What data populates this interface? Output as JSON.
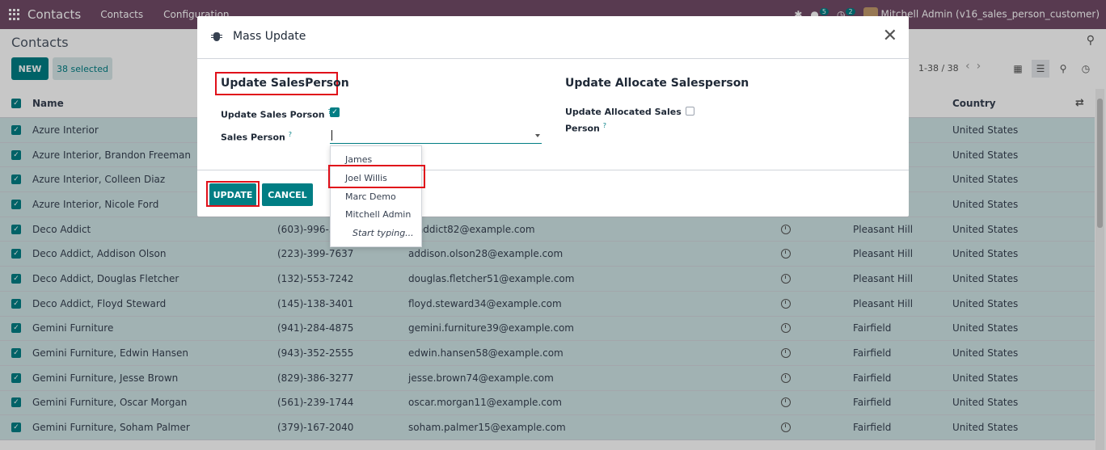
{
  "navbar": {
    "brand": "Contacts",
    "menu": [
      "Contacts",
      "Configuration"
    ],
    "chat_count": "5",
    "activity_count": "2",
    "user": "Mitchell Admin (v16_sales_person_customer)"
  },
  "control_panel": {
    "breadcrumb": "Contacts",
    "new_label": "NEW",
    "selected_label": "38 selected",
    "pager": "1-38 / 38"
  },
  "list": {
    "headers": {
      "name": "Name",
      "country": "Country"
    },
    "rows": [
      {
        "name": "Azure Interior",
        "phone": "",
        "email": "",
        "city": "",
        "country": "United States"
      },
      {
        "name": "Azure Interior, Brandon Freeman",
        "phone": "",
        "email": "",
        "city": "",
        "country": "United States"
      },
      {
        "name": "Azure Interior, Colleen Diaz",
        "phone": "",
        "email": "",
        "city": "",
        "country": "United States"
      },
      {
        "name": "Azure Interior, Nicole Ford",
        "phone": "",
        "email": "",
        "city": "",
        "country": "United States"
      },
      {
        "name": "Deco Addict",
        "phone": "(603)-996-38",
        "email": "o.addict82@example.com",
        "city": "Pleasant Hill",
        "country": "United States"
      },
      {
        "name": "Deco Addict, Addison Olson",
        "phone": "(223)-399-7637",
        "email": "addison.olson28@example.com",
        "city": "Pleasant Hill",
        "country": "United States"
      },
      {
        "name": "Deco Addict, Douglas Fletcher",
        "phone": "(132)-553-7242",
        "email": "douglas.fletcher51@example.com",
        "city": "Pleasant Hill",
        "country": "United States"
      },
      {
        "name": "Deco Addict, Floyd Steward",
        "phone": "(145)-138-3401",
        "email": "floyd.steward34@example.com",
        "city": "Pleasant Hill",
        "country": "United States"
      },
      {
        "name": "Gemini Furniture",
        "phone": "(941)-284-4875",
        "email": "gemini.furniture39@example.com",
        "city": "Fairfield",
        "country": "United States"
      },
      {
        "name": "Gemini Furniture, Edwin Hansen",
        "phone": "(943)-352-2555",
        "email": "edwin.hansen58@example.com",
        "city": "Fairfield",
        "country": "United States"
      },
      {
        "name": "Gemini Furniture, Jesse Brown",
        "phone": "(829)-386-3277",
        "email": "jesse.brown74@example.com",
        "city": "Fairfield",
        "country": "United States"
      },
      {
        "name": "Gemini Furniture, Oscar Morgan",
        "phone": "(561)-239-1744",
        "email": "oscar.morgan11@example.com",
        "city": "Fairfield",
        "country": "United States"
      },
      {
        "name": "Gemini Furniture, Soham Palmer",
        "phone": "(379)-167-2040",
        "email": "soham.palmer15@example.com",
        "city": "Fairfield",
        "country": "United States"
      }
    ]
  },
  "modal": {
    "title": "Mass Update",
    "left_section": "Update SalesPerson",
    "right_section": "Update Allocate Salesperson",
    "update_sales_person_label": "Update Sales Porson",
    "sales_person_label": "Sales Person",
    "allocated_label_1": "Update Allocated Sales",
    "allocated_label_2": "Person",
    "help_mark": "?",
    "update_button": "UPDATE",
    "cancel_button": "CANCEL"
  },
  "dropdown": {
    "options": [
      "James",
      "Joel Willis",
      "Marc Demo",
      "Mitchell Admin"
    ],
    "hint": "Start typing..."
  },
  "colors": {
    "brand": "#714b67",
    "accent": "#017e84",
    "highlight": "#e0101a"
  }
}
